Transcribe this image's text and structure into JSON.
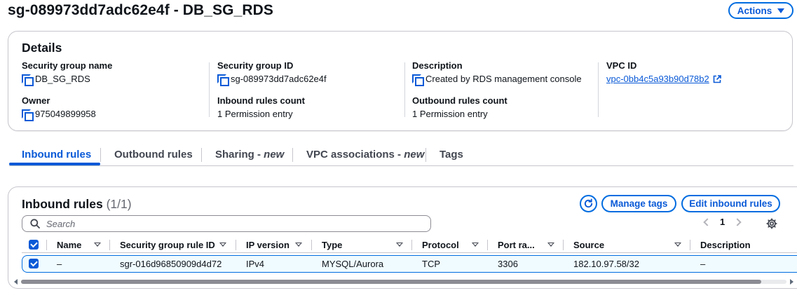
{
  "header": {
    "title": "sg-089973dd7adc62e4f - DB_SG_RDS",
    "actions_label": "Actions"
  },
  "details": {
    "title": "Details",
    "fields": {
      "sg_name": {
        "label": "Security group name",
        "value": "DB_SG_RDS"
      },
      "sg_id": {
        "label": "Security group ID",
        "value": "sg-089973dd7adc62e4f"
      },
      "description": {
        "label": "Description",
        "value": "Created by RDS management console"
      },
      "vpc_id": {
        "label": "VPC ID",
        "value": "vpc-0bb4c5a93b90d78b2"
      },
      "owner": {
        "label": "Owner",
        "value": "975049899958"
      },
      "inbound_count": {
        "label": "Inbound rules count",
        "value": "1 Permission entry"
      },
      "outbound_count": {
        "label": "Outbound rules count",
        "value": "1 Permission entry"
      }
    }
  },
  "tabs": [
    {
      "label": "Inbound rules",
      "suffix": "",
      "active": true
    },
    {
      "label": "Outbound rules",
      "suffix": "",
      "active": false
    },
    {
      "label": "Sharing - ",
      "suffix": "new",
      "active": false
    },
    {
      "label": "VPC associations - ",
      "suffix": "new",
      "active": false
    },
    {
      "label": "Tags",
      "suffix": "",
      "active": false
    }
  ],
  "inbound": {
    "title": "Inbound rules",
    "count": "(1/1)",
    "manage_tags_label": "Manage tags",
    "edit_label": "Edit inbound rules",
    "search_placeholder": "Search",
    "page": "1",
    "columns": [
      "Name",
      "Security group rule ID",
      "IP version",
      "Type",
      "Protocol",
      "Port ra...",
      "Source",
      "Description"
    ],
    "rows": [
      {
        "name": "–",
        "rule_id": "sgr-016d96850909d4d72",
        "ip_version": "IPv4",
        "type": "MYSQL/Aurora",
        "protocol": "TCP",
        "port": "3306",
        "source": "182.10.97.58/32",
        "description": "–",
        "selected": true
      }
    ]
  },
  "colors": {
    "accent": "#0a5ad7",
    "text": "#0f141a",
    "border": "#c6c6cd",
    "row_selected_bg": "#f0fbff"
  }
}
